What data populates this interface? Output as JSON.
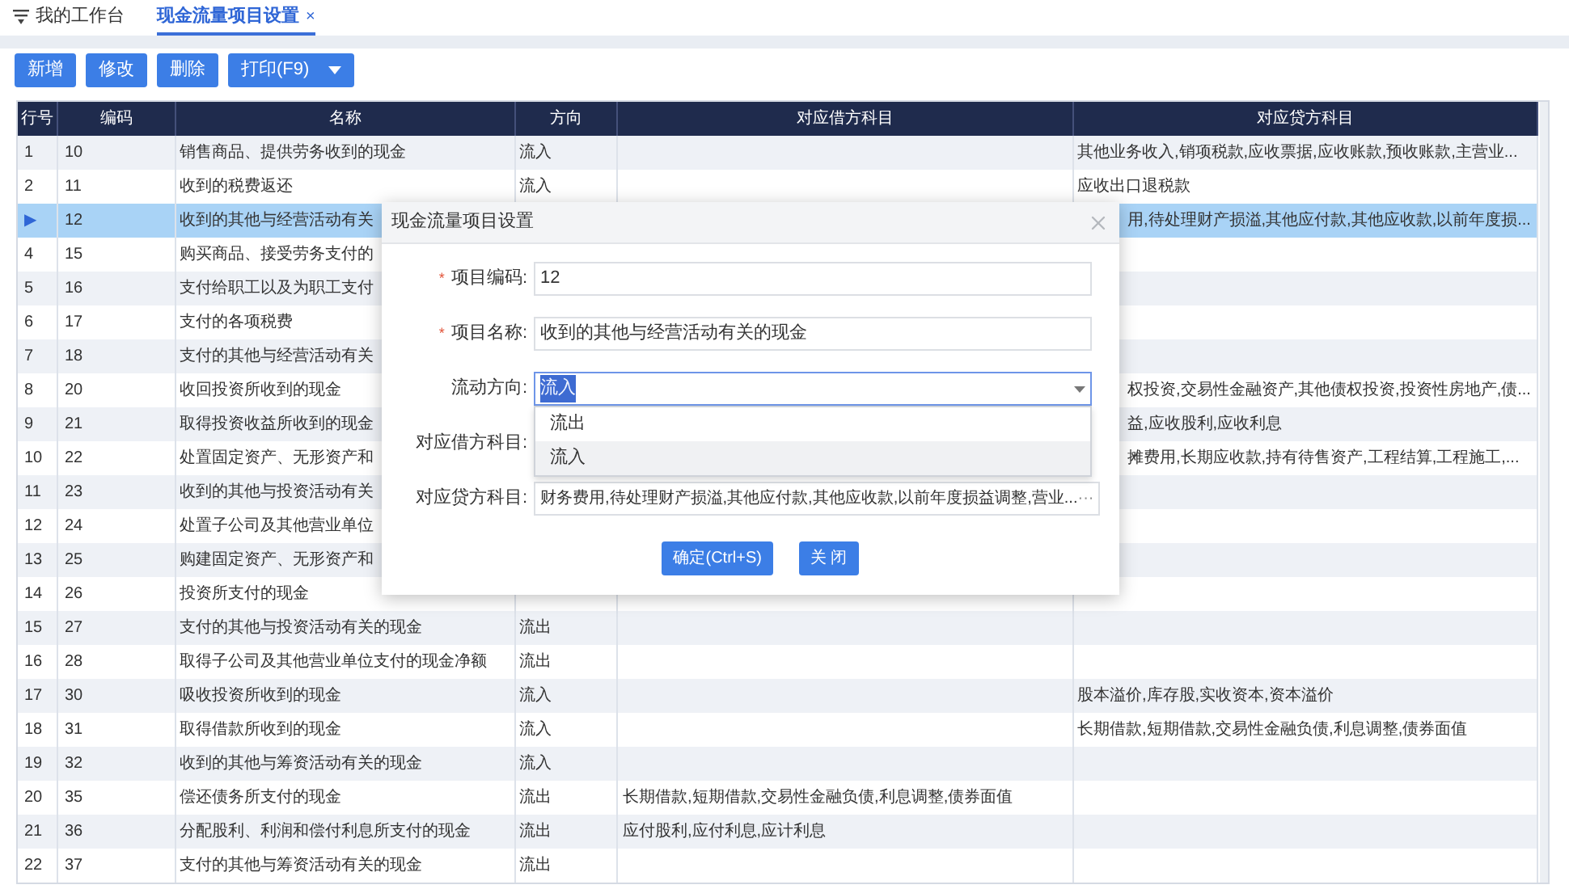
{
  "tabs": [
    {
      "label": "我的工作台",
      "selected": false
    },
    {
      "label": "现金流量项目设置",
      "selected": true,
      "close": "×"
    }
  ],
  "toolbar": [
    {
      "label": "新增"
    },
    {
      "label": "修改"
    },
    {
      "label": "删除"
    },
    {
      "label": "打印(F9)",
      "dropdown": true
    }
  ],
  "table": {
    "columns": [
      "行号",
      "编码",
      "名称",
      "方向",
      "对应借方科目",
      "对应贷方科目"
    ],
    "rows": [
      {
        "no": "1",
        "code": "10",
        "name": "销售商品、提供劳务收到的现金",
        "direction": "流入",
        "debit": "",
        "credit": "其他业务收入,销项税款,应收票据,应收账款,预收账款,主营业...",
        "selected": false
      },
      {
        "no": "2",
        "code": "11",
        "name": "收到的税费返还",
        "direction": "流入",
        "debit": "",
        "credit": "应收出口退税款",
        "selected": false
      },
      {
        "no": "▶",
        "code": "12",
        "name": "收到的其他与经营活动有关",
        "direction": "",
        "debit": "",
        "credit": "用,待处理财产损溢,其他应付款,其他应收款,以前年度损...",
        "selected": true
      },
      {
        "no": "4",
        "code": "15",
        "name": "购买商品、接受劳务支付的",
        "direction": "",
        "debit": "",
        "credit": "",
        "selected": false
      },
      {
        "no": "5",
        "code": "16",
        "name": "支付给职工以及为职工支付",
        "direction": "",
        "debit": "",
        "credit": "",
        "selected": false
      },
      {
        "no": "6",
        "code": "17",
        "name": "支付的各项税费",
        "direction": "",
        "debit": "",
        "credit": "",
        "selected": false
      },
      {
        "no": "7",
        "code": "18",
        "name": "支付的其他与经营活动有关",
        "direction": "",
        "debit": "",
        "credit": "",
        "selected": false
      },
      {
        "no": "8",
        "code": "20",
        "name": "收回投资所收到的现金",
        "direction": "",
        "debit": "",
        "credit": "权投资,交易性金融资产,其他债权投资,投资性房地产,债...",
        "selected": false
      },
      {
        "no": "9",
        "code": "21",
        "name": "取得投资收益所收到的现金",
        "direction": "",
        "debit": "",
        "credit": "益,应收股利,应收利息",
        "selected": false
      },
      {
        "no": "10",
        "code": "22",
        "name": "处置固定资产、无形资产和",
        "direction": "",
        "debit": "",
        "credit": "摊费用,长期应收款,持有待售资产,工程结算,工程施工,...",
        "selected": false
      },
      {
        "no": "11",
        "code": "23",
        "name": "收到的其他与投资活动有关",
        "direction": "",
        "debit": "",
        "credit": "",
        "selected": false
      },
      {
        "no": "12",
        "code": "24",
        "name": "处置子公司及其他营业单位",
        "direction": "",
        "debit": "",
        "credit": "",
        "selected": false
      },
      {
        "no": "13",
        "code": "25",
        "name": "购建固定资产、无形资产和",
        "direction": "",
        "debit": "",
        "credit": "",
        "selected": false
      },
      {
        "no": "14",
        "code": "26",
        "name": "投资所支付的现金",
        "direction": "",
        "debit": "",
        "credit": "",
        "selected": false
      },
      {
        "no": "15",
        "code": "27",
        "name": "支付的其他与投资活动有关的现金",
        "direction": "流出",
        "debit": "",
        "credit": "",
        "selected": false
      },
      {
        "no": "16",
        "code": "28",
        "name": "取得子公司及其他营业单位支付的现金净额",
        "direction": "流出",
        "debit": "",
        "credit": "",
        "selected": false
      },
      {
        "no": "17",
        "code": "30",
        "name": "吸收投资所收到的现金",
        "direction": "流入",
        "debit": "",
        "credit": "股本溢价,库存股,实收资本,资本溢价",
        "selected": false
      },
      {
        "no": "18",
        "code": "31",
        "name": "取得借款所收到的现金",
        "direction": "流入",
        "debit": "",
        "credit": "长期借款,短期借款,交易性金融负债,利息调整,债券面值",
        "selected": false
      },
      {
        "no": "19",
        "code": "32",
        "name": "收到的其他与筹资活动有关的现金",
        "direction": "流入",
        "debit": "",
        "credit": "",
        "selected": false
      },
      {
        "no": "20",
        "code": "35",
        "name": "偿还债务所支付的现金",
        "direction": "流出",
        "debit": "长期借款,短期借款,交易性金融负债,利息调整,债券面值",
        "credit": "",
        "selected": false
      },
      {
        "no": "21",
        "code": "36",
        "name": "分配股利、利润和偿付利息所支付的现金",
        "direction": "流出",
        "debit": "应付股利,应付利息,应计利息",
        "credit": "",
        "selected": false
      },
      {
        "no": "22",
        "code": "37",
        "name": "支付的其他与筹资活动有关的现金",
        "direction": "流出",
        "debit": "",
        "credit": "",
        "selected": false
      }
    ]
  },
  "dialog": {
    "title": "现金流量项目设置",
    "fields": [
      {
        "kind": "text",
        "label": "项目编码:",
        "required_mark": "*",
        "value": "12"
      },
      {
        "kind": "text",
        "label": "项目名称:",
        "required_mark": "*",
        "value": "收到的其他与经营活动有关的现金"
      },
      {
        "kind": "select",
        "label": "流动方向:",
        "value": "流入",
        "options": [
          {
            "label": "流出",
            "selected": false
          },
          {
            "label": "流入",
            "selected": true
          }
        ]
      },
      {
        "kind": "hidden",
        "label": "对应借方科目:"
      },
      {
        "kind": "picker",
        "label": "对应贷方科目:",
        "value": "财务费用,待处理财产损溢,其他应付款,其他应收款,以前年度损益调整,营业...",
        "more": "···"
      }
    ],
    "buttons": [
      {
        "label": "确定(Ctrl+S)"
      },
      {
        "label": "关 闭"
      }
    ]
  }
}
